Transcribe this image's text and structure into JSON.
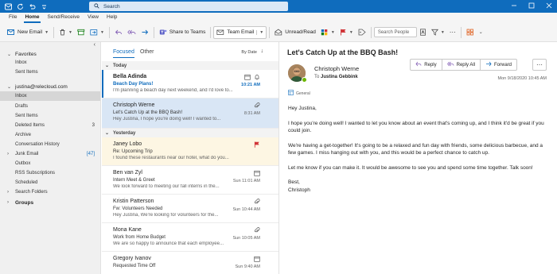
{
  "title_bar": {
    "search_placeholder": "Search"
  },
  "menu": {
    "tabs": [
      "File",
      "Home",
      "Send/Receive",
      "View",
      "Help"
    ],
    "active": "Home"
  },
  "ribbon": {
    "new_email": "New Email",
    "share_to_teams": "Share to Teams",
    "team_email": "Team Email",
    "unread_read": "Unread/Read",
    "search_people": "Search People"
  },
  "folders": {
    "favorites_header": "Favorites",
    "favorites": [
      {
        "label": "Inbox",
        "count": ""
      },
      {
        "label": "Sent Items",
        "count": ""
      }
    ],
    "account": "justina@relecloud.com",
    "items": [
      {
        "label": "Inbox",
        "count": ""
      },
      {
        "label": "Drafts",
        "count": ""
      },
      {
        "label": "Sent Items",
        "count": ""
      },
      {
        "label": "Deleted Items",
        "count": "3"
      },
      {
        "label": "Archive",
        "count": ""
      },
      {
        "label": "Conversation History",
        "count": ""
      },
      {
        "label": "Junk Email",
        "count": "[47]"
      },
      {
        "label": "Outbox",
        "count": ""
      },
      {
        "label": "RSS Subscriptions",
        "count": ""
      },
      {
        "label": "Scheduled",
        "count": ""
      },
      {
        "label": "Search Folders",
        "count": ""
      }
    ],
    "groups": "Groups"
  },
  "message_list": {
    "tab_focused": "Focused",
    "tab_other": "Other",
    "sort_by": "By Date",
    "group_today": "Today",
    "group_yesterday": "Yesterday",
    "messages": [
      {
        "sender": "Bella Adinda",
        "subject": "Beach Day Plans!",
        "preview": "I'm planning a beach day next weekend, and I'd love to...",
        "time": "10:21 AM"
      },
      {
        "sender": "Christoph Werne",
        "subject": "Let's Catch Up at the BBQ Bash!",
        "preview": "Hey Justina, I hope you're doing well! I wanted to...",
        "time": "8:31 AM"
      },
      {
        "sender": "Janey Lobo",
        "subject": "Re: Upcoming Trip",
        "preview": "I found these restaurants near our hotel, what do you...",
        "time": ""
      },
      {
        "sender": "Ben van Zyl",
        "subject": "Intern Meet & Greet",
        "preview": "We look forward to meeting our fall interns in the...",
        "time": "Sun 11:01 AM"
      },
      {
        "sender": "Kristin Patterson",
        "subject": "Fw: Volunteers Needed",
        "preview": "Hey Justina, We're looking for volunteers for the...",
        "time": "Sun 10:44 AM"
      },
      {
        "sender": "Mona Kane",
        "subject": "Work from Home Budget",
        "preview": "We are so happy to announce that each employee...",
        "time": "Sun 10:05 AM"
      },
      {
        "sender": "Gregory Ivanov",
        "subject": "Requested Time Off",
        "preview": "",
        "time": "Sun 9:40 AM"
      }
    ]
  },
  "reading_pane": {
    "subject": "Let's Catch Up at the BBQ Bash!",
    "from": "Christoph Werne",
    "to_label": "To",
    "to": "Justina Gebbink",
    "date": "Mon 9/18/2020 10:45 AM",
    "category": "General",
    "reply": "Reply",
    "reply_all": "Reply All",
    "forward": "Forward",
    "body": [
      "Hey Justina,",
      "I hope you're doing well! I wanted to let you know about an event that's coming up, and I think it'd be great if you could join.",
      "We're having a get-together! It's going to be a relaxed and fun day with friends, some delicious barbecue, and a few games. I miss hanging out with you, and this would be a perfect chance to catch up.",
      "Let me know if you can make it. It would be awesome to see you and spend some time together. Talk soon!",
      "Best,\nChristoph"
    ]
  },
  "colors": {
    "accent": "#0f6cbd",
    "flag": "#d13438"
  }
}
